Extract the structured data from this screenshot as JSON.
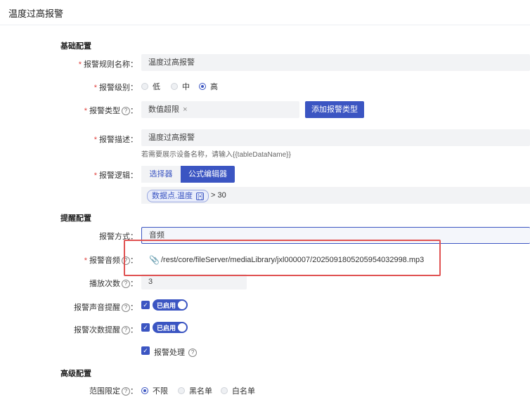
{
  "page": {
    "title": "温度过高报警"
  },
  "sections": {
    "basic": "基础配置",
    "reminder": "提醒配置",
    "advanced": "高级配置"
  },
  "rule_name": {
    "label": "报警规则名称",
    "value": "温度过高报警"
  },
  "level": {
    "label": "报警级别",
    "options": [
      "低",
      "中",
      "高"
    ],
    "selected": "高"
  },
  "alarm_type": {
    "label": "报警类型",
    "tag": "数值超限",
    "remove": "×",
    "add_button": "添加报警类型",
    "help": "?"
  },
  "description": {
    "label": "报警描述",
    "value": "温度过高报警",
    "hint": "若需要展示设备名称，请输入{{tableDataName}}"
  },
  "logic": {
    "label": "报警逻辑",
    "tabs": [
      "选择器",
      "公式编辑器"
    ],
    "active_tab": "公式编辑器",
    "expr_tag": "数据点.温度",
    "expr_rest": "> 30"
  },
  "method": {
    "label": "报警方式",
    "value": "音频"
  },
  "sound": {
    "label": "报警音频",
    "file": "/rest/core/fileServer/mediaLibrary/jxl000007/20250918052059540329​98.mp3",
    "help": "?"
  },
  "play_count": {
    "label": "播放次数",
    "value": "3",
    "help": "?"
  },
  "sound_alert": {
    "label": "报警声音提醒",
    "switch_text": "已启用",
    "help": "?"
  },
  "count_alert": {
    "label": "报警次数提醒",
    "switch_text": "已启用",
    "help": "?"
  },
  "handle": {
    "label": "报警处理",
    "help": "?"
  },
  "scope": {
    "label": "范围限定",
    "options": [
      "不限",
      "黑名单",
      "白名单"
    ],
    "selected": "不限",
    "help": "?"
  },
  "colors": {
    "primary": "#3b55c2",
    "required": "#e0403c",
    "highlight": "#e05252"
  }
}
